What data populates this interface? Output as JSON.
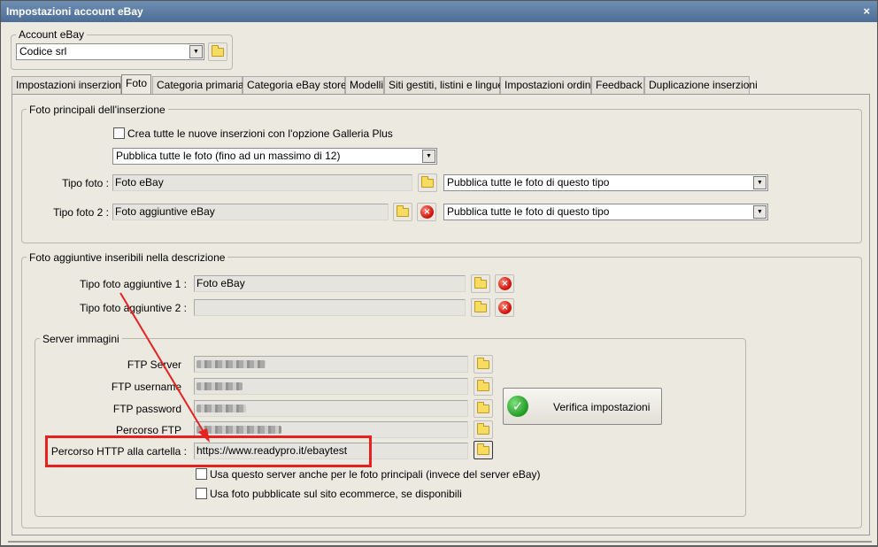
{
  "window": {
    "title": "Impostazioni account eBay",
    "close_glyph": "×"
  },
  "account": {
    "legend": "Account eBay",
    "value": "Codice srl"
  },
  "tabs": [
    "Impostazioni inserzioni",
    "Foto",
    "Categoria primaria",
    "Categoria eBay store",
    "Modelli",
    "Siti gestiti, listini e lingue",
    "Impostazioni ordini",
    "Feedback",
    "Duplicazione inserzioni"
  ],
  "main_photos": {
    "legend": "Foto principali dell'inserzione",
    "galleria_plus_label": "Crea tutte le nuove inserzioni con l'opzione Galleria Plus",
    "publish_select": "Pubblica tutte le foto (fino ad un massimo di 12)",
    "tipo_foto_label": "Tipo foto :",
    "tipo_foto_value": "Foto eBay",
    "tipo_foto_select": "Pubblica tutte le foto di questo tipo",
    "tipo_foto2_label": "Tipo foto 2 :",
    "tipo_foto2_value": "Foto aggiuntive eBay",
    "tipo_foto2_select": "Pubblica tutte le foto di questo tipo"
  },
  "extra_photos": {
    "legend": "Foto aggiuntive inseribili nella descrizione",
    "tipo1_label": "Tipo foto aggiuntive 1 :",
    "tipo1_value": "Foto eBay",
    "tipo2_label": "Tipo foto aggiuntive 2 :",
    "tipo2_value": ""
  },
  "server": {
    "legend": "Server immagini",
    "ftp_server_label": "FTP Server",
    "ftp_username_label": "FTP username",
    "ftp_password_label": "FTP password",
    "percorso_ftp_label": "Percorso FTP",
    "http_label": "Percorso HTTP alla cartella :",
    "http_value": "https://www.readypro.it/ebaytest",
    "use_server_label": "Usa questo server anche per le foto principali (invece del server eBay)",
    "use_ecommerce_label": "Usa foto pubblicate sul sito ecommerce, se disponibili",
    "verify_button": "Verifica impostazioni"
  },
  "colors": {
    "annotation": "#e52220",
    "titlebar": "#5b7ba3"
  },
  "icons": {
    "folder": "folder-icon",
    "delete": "delete-icon",
    "check": "check-icon",
    "dropdown": "dropdown-arrow-icon"
  }
}
